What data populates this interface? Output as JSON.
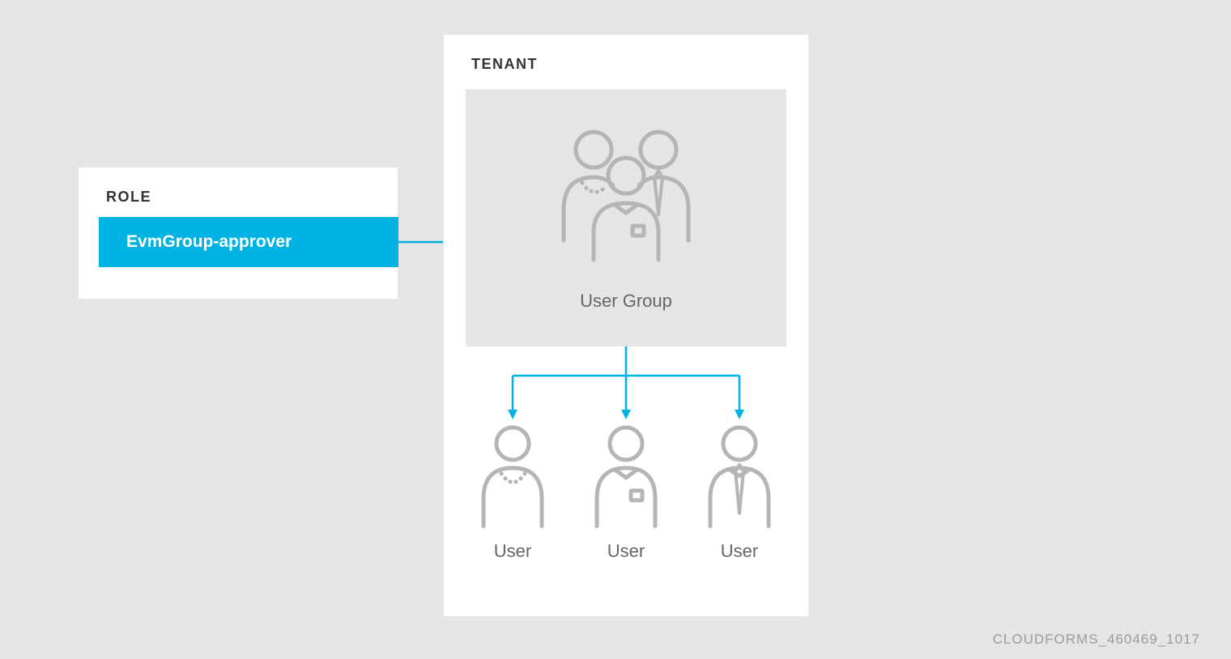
{
  "role": {
    "heading": "ROLE",
    "chip_label": "EvmGroup-approver"
  },
  "tenant": {
    "heading": "TENANT",
    "usergroup_label": "User Group",
    "users": [
      {
        "label": "User"
      },
      {
        "label": "User"
      },
      {
        "label": "User"
      }
    ]
  },
  "footer_id": "CLOUDFORMS_460469_1017",
  "colors": {
    "accent": "#00b3e3",
    "bg": "#e5e5e5",
    "panel": "#ffffff",
    "icon_stroke": "#b5b5b5",
    "text_dark": "#333333",
    "text_mid": "#666666",
    "text_light": "#9b9b9b"
  }
}
